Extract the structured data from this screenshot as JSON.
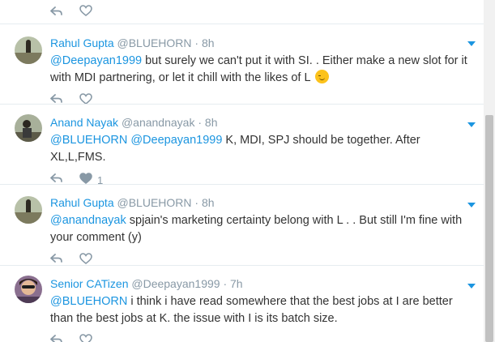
{
  "colors": {
    "accent": "#1b95e0",
    "muted": "#8899a6",
    "text": "#333333"
  },
  "tweets": [
    {
      "name": "Rahul Gupta",
      "handle": "@BLUEHORN",
      "time": "8h",
      "mention": "@Deepayan1999",
      "body": " but surely we can't put it with SI. . Either make a new slot for it with MDI partnering, or let it chill with the likes of L",
      "like_count": ""
    },
    {
      "name": "Anand Nayak",
      "handle": "@anandnayak",
      "time": "8h",
      "mention": "@BLUEHORN @Deepayan1999",
      "body": " K, MDI, SPJ should be together. After XL,L,FMS.",
      "like_count": "1"
    },
    {
      "name": "Rahul Gupta",
      "handle": "@BLUEHORN",
      "time": "8h",
      "mention": "@anandnayak",
      "body": " spjain's marketing certainty belong with L . . But still I'm fine with your comment (y)",
      "like_count": ""
    },
    {
      "name": "Senior CATizen",
      "handle": "@Deepayan1999",
      "time": "7h",
      "mention": "@BLUEHORN",
      "body": " i think i have read somewhere that the best jobs at I are better than the best jobs at K. the issue with I is its batch size.",
      "like_count": ""
    }
  ]
}
